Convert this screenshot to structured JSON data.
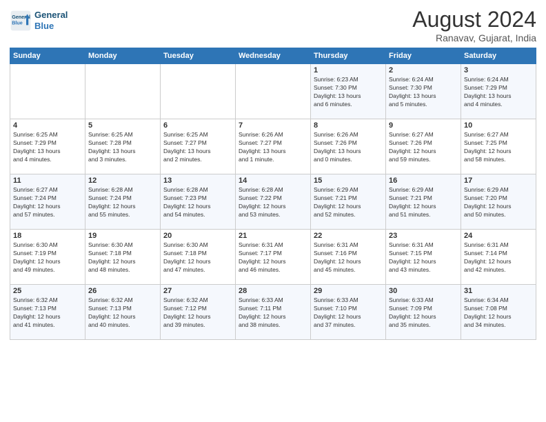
{
  "header": {
    "logo_line1": "General",
    "logo_line2": "Blue",
    "month_year": "August 2024",
    "location": "Ranavav, Gujarat, India"
  },
  "weekdays": [
    "Sunday",
    "Monday",
    "Tuesday",
    "Wednesday",
    "Thursday",
    "Friday",
    "Saturday"
  ],
  "weeks": [
    [
      {
        "day": "",
        "info": ""
      },
      {
        "day": "",
        "info": ""
      },
      {
        "day": "",
        "info": ""
      },
      {
        "day": "",
        "info": ""
      },
      {
        "day": "1",
        "info": "Sunrise: 6:23 AM\nSunset: 7:30 PM\nDaylight: 13 hours\nand 6 minutes."
      },
      {
        "day": "2",
        "info": "Sunrise: 6:24 AM\nSunset: 7:30 PM\nDaylight: 13 hours\nand 5 minutes."
      },
      {
        "day": "3",
        "info": "Sunrise: 6:24 AM\nSunset: 7:29 PM\nDaylight: 13 hours\nand 4 minutes."
      }
    ],
    [
      {
        "day": "4",
        "info": "Sunrise: 6:25 AM\nSunset: 7:29 PM\nDaylight: 13 hours\nand 4 minutes."
      },
      {
        "day": "5",
        "info": "Sunrise: 6:25 AM\nSunset: 7:28 PM\nDaylight: 13 hours\nand 3 minutes."
      },
      {
        "day": "6",
        "info": "Sunrise: 6:25 AM\nSunset: 7:27 PM\nDaylight: 13 hours\nand 2 minutes."
      },
      {
        "day": "7",
        "info": "Sunrise: 6:26 AM\nSunset: 7:27 PM\nDaylight: 13 hours\nand 1 minute."
      },
      {
        "day": "8",
        "info": "Sunrise: 6:26 AM\nSunset: 7:26 PM\nDaylight: 13 hours\nand 0 minutes."
      },
      {
        "day": "9",
        "info": "Sunrise: 6:27 AM\nSunset: 7:26 PM\nDaylight: 12 hours\nand 59 minutes."
      },
      {
        "day": "10",
        "info": "Sunrise: 6:27 AM\nSunset: 7:25 PM\nDaylight: 12 hours\nand 58 minutes."
      }
    ],
    [
      {
        "day": "11",
        "info": "Sunrise: 6:27 AM\nSunset: 7:24 PM\nDaylight: 12 hours\nand 57 minutes."
      },
      {
        "day": "12",
        "info": "Sunrise: 6:28 AM\nSunset: 7:24 PM\nDaylight: 12 hours\nand 55 minutes."
      },
      {
        "day": "13",
        "info": "Sunrise: 6:28 AM\nSunset: 7:23 PM\nDaylight: 12 hours\nand 54 minutes."
      },
      {
        "day": "14",
        "info": "Sunrise: 6:28 AM\nSunset: 7:22 PM\nDaylight: 12 hours\nand 53 minutes."
      },
      {
        "day": "15",
        "info": "Sunrise: 6:29 AM\nSunset: 7:21 PM\nDaylight: 12 hours\nand 52 minutes."
      },
      {
        "day": "16",
        "info": "Sunrise: 6:29 AM\nSunset: 7:21 PM\nDaylight: 12 hours\nand 51 minutes."
      },
      {
        "day": "17",
        "info": "Sunrise: 6:29 AM\nSunset: 7:20 PM\nDaylight: 12 hours\nand 50 minutes."
      }
    ],
    [
      {
        "day": "18",
        "info": "Sunrise: 6:30 AM\nSunset: 7:19 PM\nDaylight: 12 hours\nand 49 minutes."
      },
      {
        "day": "19",
        "info": "Sunrise: 6:30 AM\nSunset: 7:18 PM\nDaylight: 12 hours\nand 48 minutes."
      },
      {
        "day": "20",
        "info": "Sunrise: 6:30 AM\nSunset: 7:18 PM\nDaylight: 12 hours\nand 47 minutes."
      },
      {
        "day": "21",
        "info": "Sunrise: 6:31 AM\nSunset: 7:17 PM\nDaylight: 12 hours\nand 46 minutes."
      },
      {
        "day": "22",
        "info": "Sunrise: 6:31 AM\nSunset: 7:16 PM\nDaylight: 12 hours\nand 45 minutes."
      },
      {
        "day": "23",
        "info": "Sunrise: 6:31 AM\nSunset: 7:15 PM\nDaylight: 12 hours\nand 43 minutes."
      },
      {
        "day": "24",
        "info": "Sunrise: 6:31 AM\nSunset: 7:14 PM\nDaylight: 12 hours\nand 42 minutes."
      }
    ],
    [
      {
        "day": "25",
        "info": "Sunrise: 6:32 AM\nSunset: 7:13 PM\nDaylight: 12 hours\nand 41 minutes."
      },
      {
        "day": "26",
        "info": "Sunrise: 6:32 AM\nSunset: 7:13 PM\nDaylight: 12 hours\nand 40 minutes."
      },
      {
        "day": "27",
        "info": "Sunrise: 6:32 AM\nSunset: 7:12 PM\nDaylight: 12 hours\nand 39 minutes."
      },
      {
        "day": "28",
        "info": "Sunrise: 6:33 AM\nSunset: 7:11 PM\nDaylight: 12 hours\nand 38 minutes."
      },
      {
        "day": "29",
        "info": "Sunrise: 6:33 AM\nSunset: 7:10 PM\nDaylight: 12 hours\nand 37 minutes."
      },
      {
        "day": "30",
        "info": "Sunrise: 6:33 AM\nSunset: 7:09 PM\nDaylight: 12 hours\nand 35 minutes."
      },
      {
        "day": "31",
        "info": "Sunrise: 6:34 AM\nSunset: 7:08 PM\nDaylight: 12 hours\nand 34 minutes."
      }
    ]
  ]
}
